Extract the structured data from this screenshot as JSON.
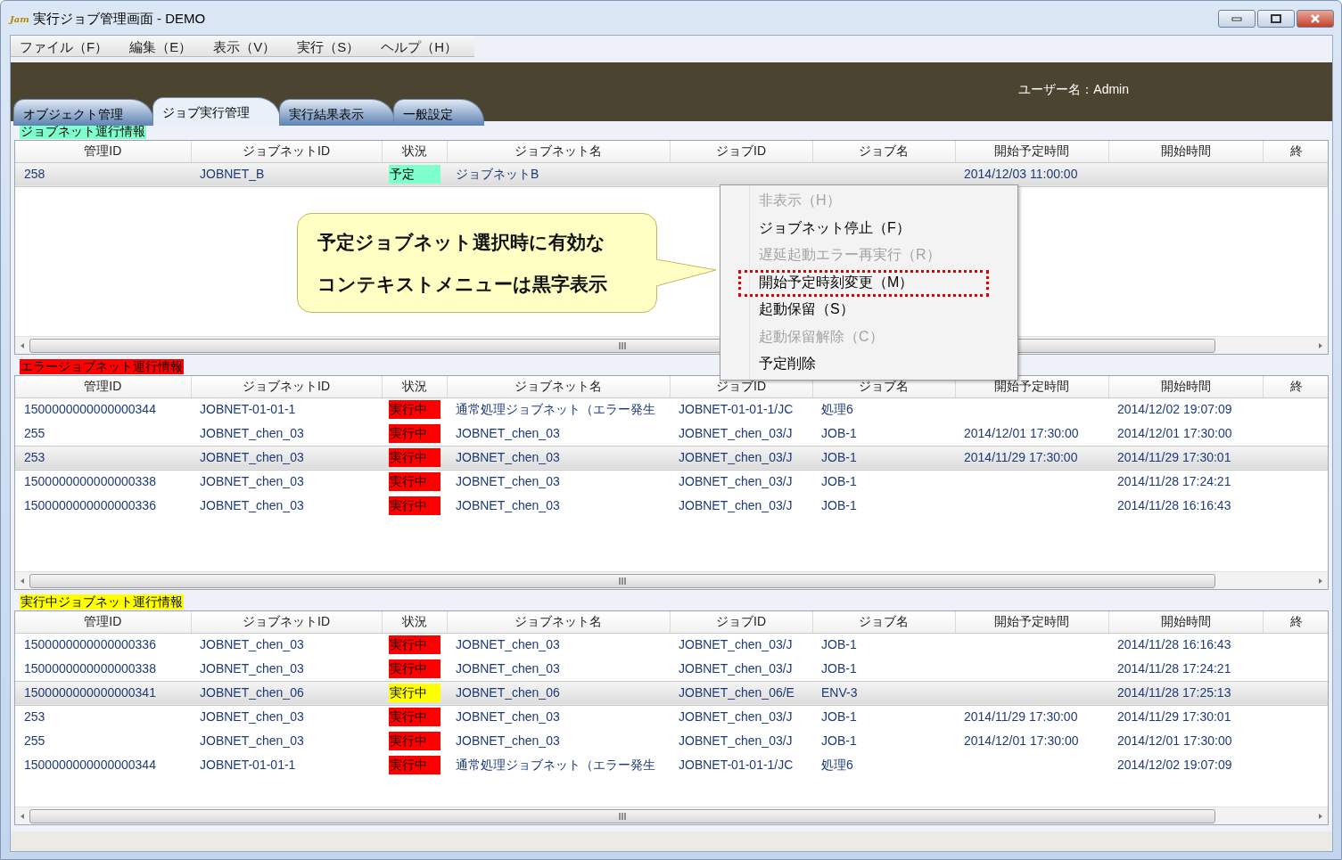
{
  "window": {
    "logo_text": "Jam",
    "title": "実行ジョブ管理画面 - DEMO"
  },
  "menu": [
    "ファイル（F）",
    "編集（E）",
    "表示（V）",
    "実行（S）",
    "ヘルプ（H）"
  ],
  "user_label": "ユーザー名：Admin",
  "tabs": [
    {
      "label": "オブジェクト管理",
      "selected": false
    },
    {
      "label": "ジョブ実行管理",
      "selected": true
    },
    {
      "label": "実行結果表示",
      "selected": false
    },
    {
      "label": "一般設定",
      "selected": false
    }
  ],
  "panels": [
    {
      "title": "ジョブネット運行情報",
      "color": "#7fffcc",
      "columns": [
        "管理ID",
        "ジョブネットID",
        "状況",
        "ジョブネット名",
        "ジョブID",
        "ジョブ名",
        "開始予定時間",
        "開始時間",
        "終"
      ],
      "rows": [
        {
          "selected": true,
          "color": "#7fffcc",
          "cells": [
            "258",
            "JOBNET_B",
            "予定",
            "ジョブネットB",
            "",
            "",
            "2014/12/03 11:00:00",
            "",
            ""
          ]
        }
      ]
    },
    {
      "title": "エラージョブネット運行情報",
      "color": "#ff0000",
      "columns": [
        "管理ID",
        "ジョブネットID",
        "状況",
        "ジョブネット名",
        "ジョブID",
        "ジョブ名",
        "開始予定時間",
        "開始時間",
        "終"
      ],
      "rows": [
        {
          "selected": false,
          "color": "#ff0000",
          "cells": [
            "1500000000000000344",
            "JOBNET-01-01-1",
            "実行中",
            "通常処理ジョブネット（エラー発生",
            "JOBNET-01-01-1/JC",
            "処理6",
            "",
            "2014/12/02 19:07:09",
            ""
          ]
        },
        {
          "selected": false,
          "color": "#ff0000",
          "cells": [
            "255",
            "JOBNET_chen_03",
            "実行中",
            "JOBNET_chen_03",
            "JOBNET_chen_03/J",
            "JOB-1",
            "2014/12/01 17:30:00",
            "2014/12/01 17:30:00",
            ""
          ]
        },
        {
          "selected": true,
          "color": "#ff0000",
          "cells": [
            "253",
            "JOBNET_chen_03",
            "実行中",
            "JOBNET_chen_03",
            "JOBNET_chen_03/J",
            "JOB-1",
            "2014/11/29 17:30:00",
            "2014/11/29 17:30:01",
            ""
          ]
        },
        {
          "selected": false,
          "color": "#ff0000",
          "cells": [
            "1500000000000000338",
            "JOBNET_chen_03",
            "実行中",
            "JOBNET_chen_03",
            "JOBNET_chen_03/J",
            "JOB-1",
            "",
            "2014/11/28 17:24:21",
            ""
          ]
        },
        {
          "selected": false,
          "color": "#ff0000",
          "cells": [
            "1500000000000000336",
            "JOBNET_chen_03",
            "実行中",
            "JOBNET_chen_03",
            "JOBNET_chen_03/J",
            "JOB-1",
            "",
            "2014/11/28 16:16:43",
            ""
          ]
        }
      ]
    },
    {
      "title": "実行中ジョブネット運行情報",
      "color": "#ffff00",
      "columns": [
        "管理ID",
        "ジョブネットID",
        "状況",
        "ジョブネット名",
        "ジョブID",
        "ジョブ名",
        "開始予定時間",
        "開始時間",
        "終"
      ],
      "rows": [
        {
          "selected": false,
          "color": "#ff0000",
          "cells": [
            "1500000000000000336",
            "JOBNET_chen_03",
            "実行中",
            "JOBNET_chen_03",
            "JOBNET_chen_03/J",
            "JOB-1",
            "",
            "2014/11/28 16:16:43",
            ""
          ]
        },
        {
          "selected": false,
          "color": "#ff0000",
          "cells": [
            "1500000000000000338",
            "JOBNET_chen_03",
            "実行中",
            "JOBNET_chen_03",
            "JOBNET_chen_03/J",
            "JOB-1",
            "",
            "2014/11/28 17:24:21",
            ""
          ]
        },
        {
          "selected": true,
          "color": "#ffff00",
          "cells": [
            "1500000000000000341",
            "JOBNET_chen_06",
            "実行中",
            "JOBNET_chen_06",
            "JOBNET_chen_06/E",
            "ENV-3",
            "",
            "2014/11/28 17:25:13",
            ""
          ]
        },
        {
          "selected": false,
          "color": "#ff0000",
          "cells": [
            "253",
            "JOBNET_chen_03",
            "実行中",
            "JOBNET_chen_03",
            "JOBNET_chen_03/J",
            "JOB-1",
            "2014/11/29 17:30:00",
            "2014/11/29 17:30:01",
            ""
          ]
        },
        {
          "selected": false,
          "color": "#ff0000",
          "cells": [
            "255",
            "JOBNET_chen_03",
            "実行中",
            "JOBNET_chen_03",
            "JOBNET_chen_03/J",
            "JOB-1",
            "2014/12/01 17:30:00",
            "2014/12/01 17:30:00",
            ""
          ]
        },
        {
          "selected": false,
          "color": "#ff0000",
          "cells": [
            "1500000000000000344",
            "JOBNET-01-01-1",
            "実行中",
            "通常処理ジョブネット（エラー発生",
            "JOBNET-01-01-1/JC",
            "処理6",
            "",
            "2014/12/02 19:07:09",
            ""
          ]
        }
      ]
    }
  ],
  "context_menu": [
    {
      "label": "非表示（H）",
      "disabled": true,
      "highlighted": false
    },
    {
      "label": "ジョブネット停止（F）",
      "disabled": false,
      "highlighted": false
    },
    {
      "label": "遅延起動エラー再実行（R）",
      "disabled": true,
      "highlighted": false
    },
    {
      "label": "開始予定時刻変更（M）",
      "disabled": false,
      "highlighted": true
    },
    {
      "label": "起動保留（S）",
      "disabled": false,
      "highlighted": false
    },
    {
      "label": "起動保留解除（C）",
      "disabled": true,
      "highlighted": false
    },
    {
      "label": "予定削除",
      "disabled": false,
      "highlighted": false
    }
  ],
  "callout": [
    "予定ジョブネット選択時に有効な",
    "コンテキストメニューは黒字表示"
  ]
}
